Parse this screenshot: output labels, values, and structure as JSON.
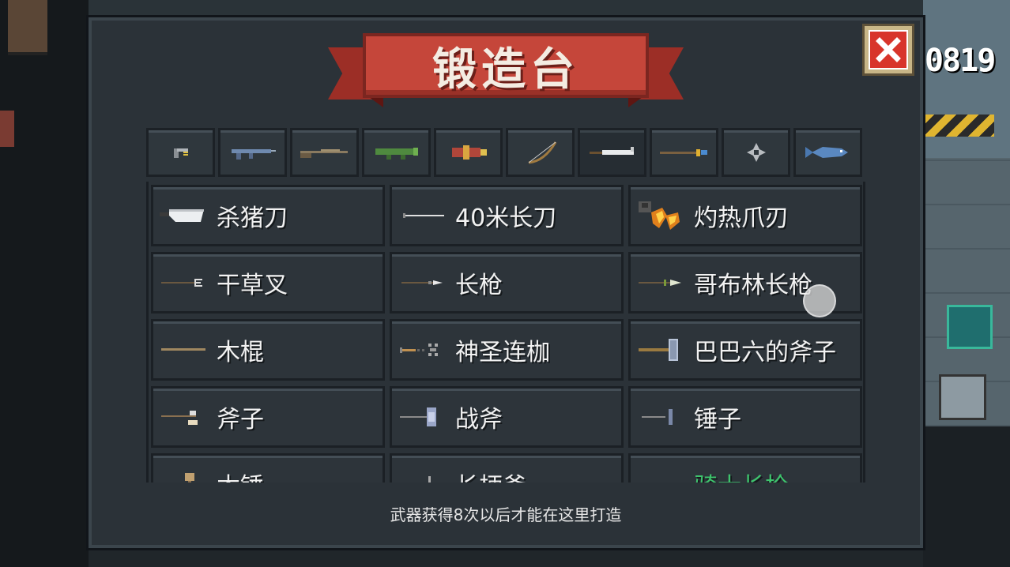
{
  "header": {
    "title": "锻造台",
    "score": "0819"
  },
  "tabs": [
    {
      "name": "pistol-icon",
      "active": false
    },
    {
      "name": "assault-rifle-icon",
      "active": false
    },
    {
      "name": "shotgun-icon",
      "active": false
    },
    {
      "name": "launcher-icon",
      "active": false
    },
    {
      "name": "explosive-icon",
      "active": false
    },
    {
      "name": "bow-icon",
      "active": false
    },
    {
      "name": "melee-blade-icon",
      "active": true
    },
    {
      "name": "staff-icon",
      "active": false
    },
    {
      "name": "throwing-star-icon",
      "active": false
    },
    {
      "name": "fish-icon",
      "active": false
    }
  ],
  "weapons": [
    {
      "label": "杀猪刀",
      "icon": "cleaver-icon",
      "green": false
    },
    {
      "label": "40米长刀",
      "icon": "long-blade-icon",
      "green": false
    },
    {
      "label": "灼热爪刃",
      "icon": "flame-claw-icon",
      "green": false
    },
    {
      "label": "干草叉",
      "icon": "pitchfork-icon",
      "green": false
    },
    {
      "label": "长枪",
      "icon": "spear-icon",
      "green": false
    },
    {
      "label": "哥布林长枪",
      "icon": "goblin-spear-icon",
      "green": false
    },
    {
      "label": "木棍",
      "icon": "wooden-stick-icon",
      "green": false
    },
    {
      "label": "神圣连枷",
      "icon": "holy-flail-icon",
      "green": false
    },
    {
      "label": "巴巴六的斧子",
      "icon": "baba-axe-icon",
      "green": false
    },
    {
      "label": "斧子",
      "icon": "axe-icon",
      "green": false
    },
    {
      "label": "战斧",
      "icon": "battle-axe-icon",
      "green": false
    },
    {
      "label": "锤子",
      "icon": "hammer-icon",
      "green": false
    },
    {
      "label": "木锤",
      "icon": "wooden-hammer-icon",
      "green": false
    },
    {
      "label": "长柄斧",
      "icon": "halberd-icon",
      "green": false
    },
    {
      "label": "骑士长枪",
      "icon": "knight-lance-icon",
      "green": true
    }
  ],
  "footer": {
    "hint": "武器获得8次以后才能在这里打造"
  },
  "colors": {
    "banner": "#c5463a",
    "panel": "#2b3238",
    "close": "#d8352b",
    "highlight_text": "#3ec46d"
  }
}
